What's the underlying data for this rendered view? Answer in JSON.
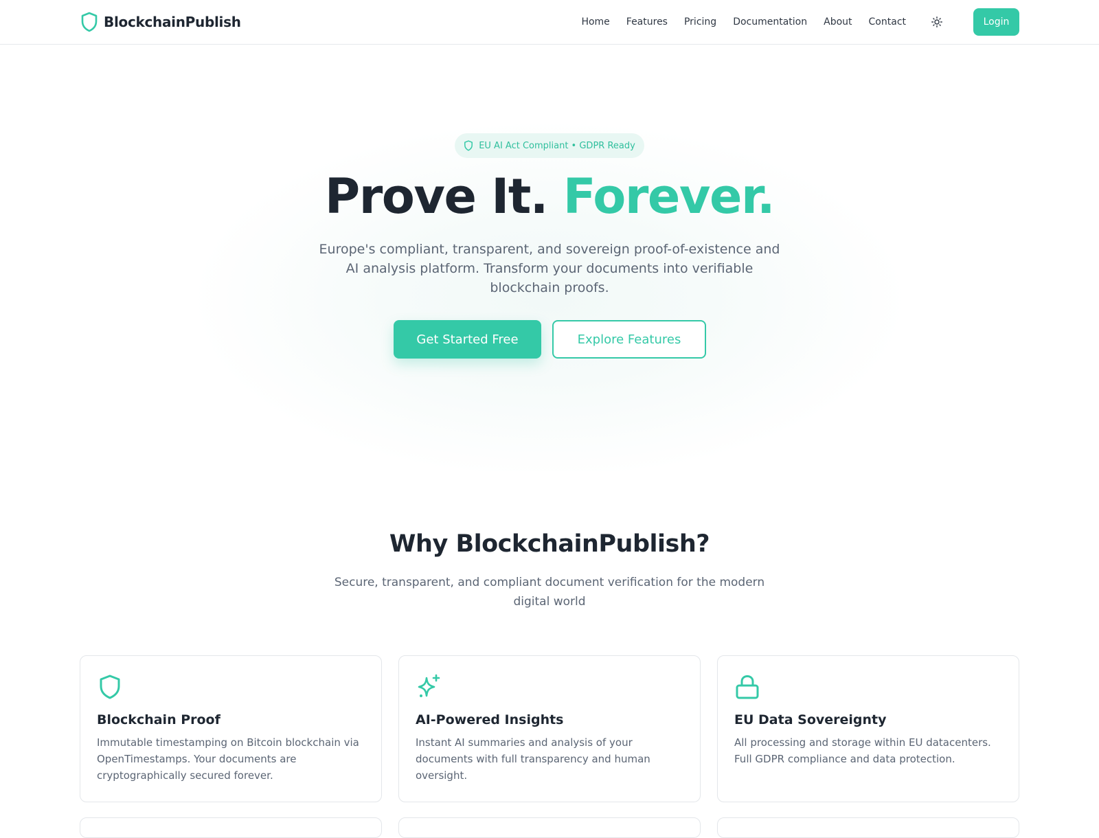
{
  "brand": {
    "name": "BlockchainPublish",
    "logo_icon": "shield-icon"
  },
  "nav": {
    "items": [
      "Home",
      "Features",
      "Pricing",
      "Documentation",
      "About",
      "Contact"
    ],
    "theme_toggle_icon": "sun-icon",
    "login_label": "Login"
  },
  "hero": {
    "badge_text": "EU AI Act Compliant • GDPR Ready",
    "title_main": "Prove It.",
    "title_accent": "Forever.",
    "subtitle": "Europe's compliant, transparent, and sovereign proof-of-existence and AI analysis platform. Transform your documents into verifiable blockchain proofs.",
    "primary_cta": "Get Started Free",
    "secondary_cta": "Explore Features"
  },
  "features": {
    "title": "Why BlockchainPublish?",
    "subtitle": "Secure, transparent, and compliant document verification for the modern digital world",
    "cards": [
      {
        "icon": "shield-icon",
        "title": "Blockchain Proof",
        "description": "Immutable timestamping on Bitcoin blockchain via OpenTimestamps. Your documents are cryptographically secured forever."
      },
      {
        "icon": "sparkles-icon",
        "title": "AI-Powered Insights",
        "description": "Instant AI summaries and analysis of your documents with full transparency and human oversight."
      },
      {
        "icon": "lock-icon",
        "title": "EU Data Sovereignty",
        "description": "All processing and storage within EU datacenters. Full GDPR compliance and data protection."
      }
    ]
  },
  "colors": {
    "accent": "#34c9a7",
    "text_dark": "#1e2631",
    "text_muted": "#5b6574",
    "badge_bg": "#e8f7f3"
  }
}
